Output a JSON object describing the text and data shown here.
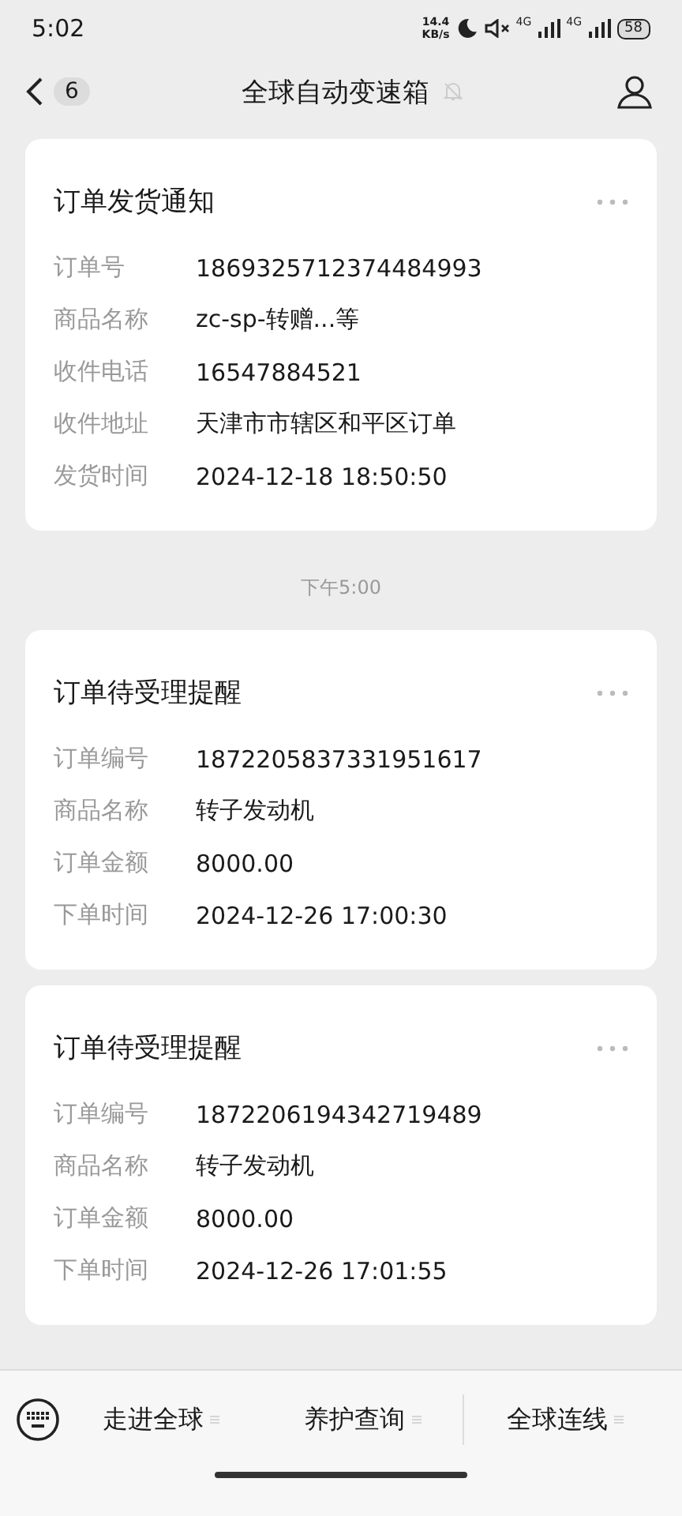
{
  "status_bar": {
    "time": "5:02",
    "speed": "14.4",
    "speed_unit": "KB/s",
    "network_1": "4G",
    "network_2": "4G",
    "battery": "58"
  },
  "header": {
    "back_count": "6",
    "title": "全球自动变速箱"
  },
  "messages": [
    {
      "kind": "card",
      "title": "订单发货通知",
      "rows": [
        {
          "label": "订单号",
          "value": "1869325712374484993"
        },
        {
          "label": "商品名称",
          "value": "zc-sp-转赠...等"
        },
        {
          "label": "收件电话",
          "value": "16547884521"
        },
        {
          "label": "收件地址",
          "value": "天津市市辖区和平区订单"
        },
        {
          "label": "发货时间",
          "value": "2024-12-18 18:50:50"
        }
      ]
    },
    {
      "kind": "time",
      "text": "下午5:00"
    },
    {
      "kind": "card",
      "title": "订单待受理提醒",
      "rows": [
        {
          "label": "订单编号",
          "value": "1872205837331951617"
        },
        {
          "label": "商品名称",
          "value": "转子发动机"
        },
        {
          "label": "订单金额",
          "value": "8000.00"
        },
        {
          "label": "下单时间",
          "value": "2024-12-26 17:00:30"
        }
      ]
    },
    {
      "kind": "card",
      "title": "订单待受理提醒",
      "rows": [
        {
          "label": "订单编号",
          "value": "1872206194342719489"
        },
        {
          "label": "商品名称",
          "value": "转子发动机"
        },
        {
          "label": "订单金额",
          "value": "8000.00"
        },
        {
          "label": "下单时间",
          "value": "2024-12-26 17:01:55"
        }
      ]
    }
  ],
  "menu": [
    "走进全球",
    "养护查询",
    "全球连线"
  ]
}
